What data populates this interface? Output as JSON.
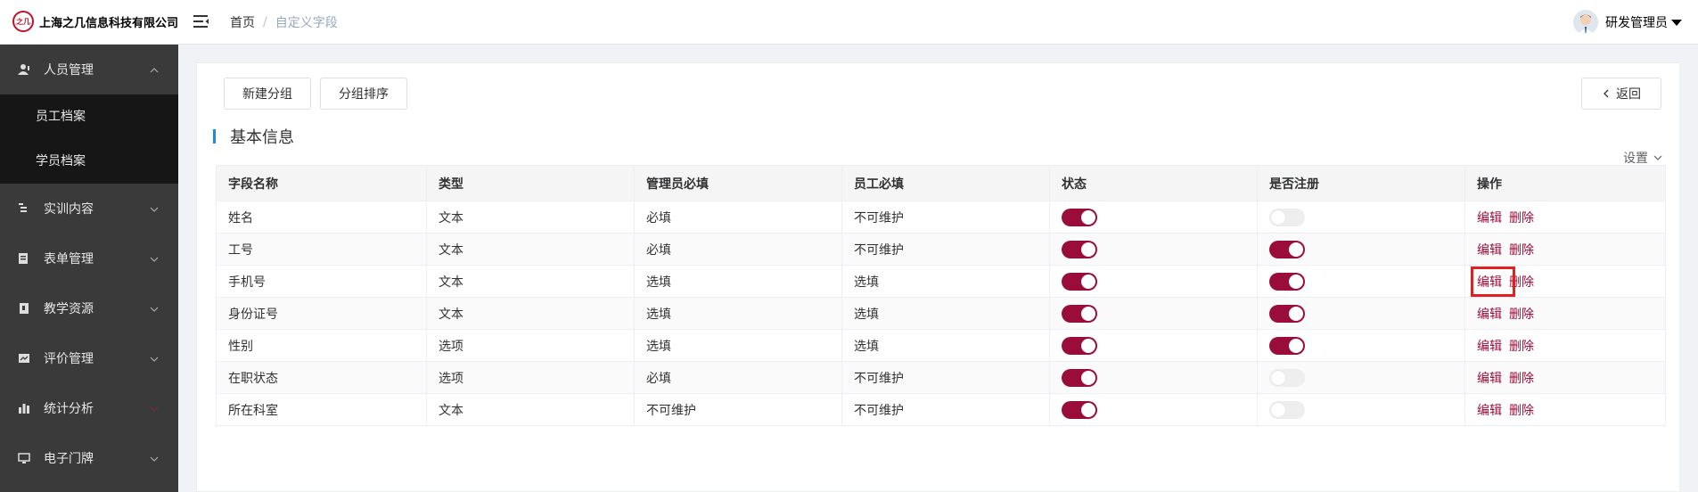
{
  "colors": {
    "accent": "#9a0d3a",
    "sidebar_bg": "#3a3a3a",
    "submenu_bg": "#161616",
    "title_bar": "#1e88e5",
    "highlight": "#e32020"
  },
  "header": {
    "company": "上海之几信息科技有限公司",
    "logo_mark": "之几",
    "breadcrumb": {
      "home": "首页",
      "separator": "/",
      "current": "自定义字段"
    },
    "user_name": "研发管理员"
  },
  "sidebar": {
    "items": [
      {
        "label": "人员管理",
        "icon": "person-icon",
        "expanded": true,
        "children": [
          "员工档案",
          "学员档案"
        ]
      },
      {
        "label": "实训内容",
        "icon": "content-icon"
      },
      {
        "label": "表单管理",
        "icon": "form-icon"
      },
      {
        "label": "教学资源",
        "icon": "resource-icon"
      },
      {
        "label": "评价管理",
        "icon": "evaluation-icon"
      },
      {
        "label": "统计分析",
        "icon": "chart-icon"
      },
      {
        "label": "电子门牌",
        "icon": "monitor-icon"
      }
    ]
  },
  "toolbar": {
    "new_group": "新建分组",
    "sort_groups": "分组排序",
    "back": "返回"
  },
  "section": {
    "title": "基本信息",
    "settings": "设置"
  },
  "table": {
    "headers": [
      "字段名称",
      "类型",
      "管理员必填",
      "员工必填",
      "状态",
      "是否注册",
      "操作"
    ],
    "actions": {
      "edit": "编辑",
      "delete": "删除"
    },
    "rows": [
      {
        "name": "姓名",
        "type": "文本",
        "admin_required": "必填",
        "staff_required": "不可维护",
        "status": true,
        "registered": false
      },
      {
        "name": "工号",
        "type": "文本",
        "admin_required": "必填",
        "staff_required": "不可维护",
        "status": true,
        "registered": true
      },
      {
        "name": "手机号",
        "type": "文本",
        "admin_required": "选填",
        "staff_required": "选填",
        "status": true,
        "registered": true
      },
      {
        "name": "身份证号",
        "type": "文本",
        "admin_required": "选填",
        "staff_required": "选填",
        "status": true,
        "registered": true
      },
      {
        "name": "性别",
        "type": "选项",
        "admin_required": "选填",
        "staff_required": "选填",
        "status": true,
        "registered": true
      },
      {
        "name": "在职状态",
        "type": "选项",
        "admin_required": "必填",
        "staff_required": "不可维护",
        "status": true,
        "registered": false
      },
      {
        "name": "所在科室",
        "type": "文本",
        "admin_required": "不可维护",
        "staff_required": "不可维护",
        "status": true,
        "registered": false
      }
    ]
  }
}
